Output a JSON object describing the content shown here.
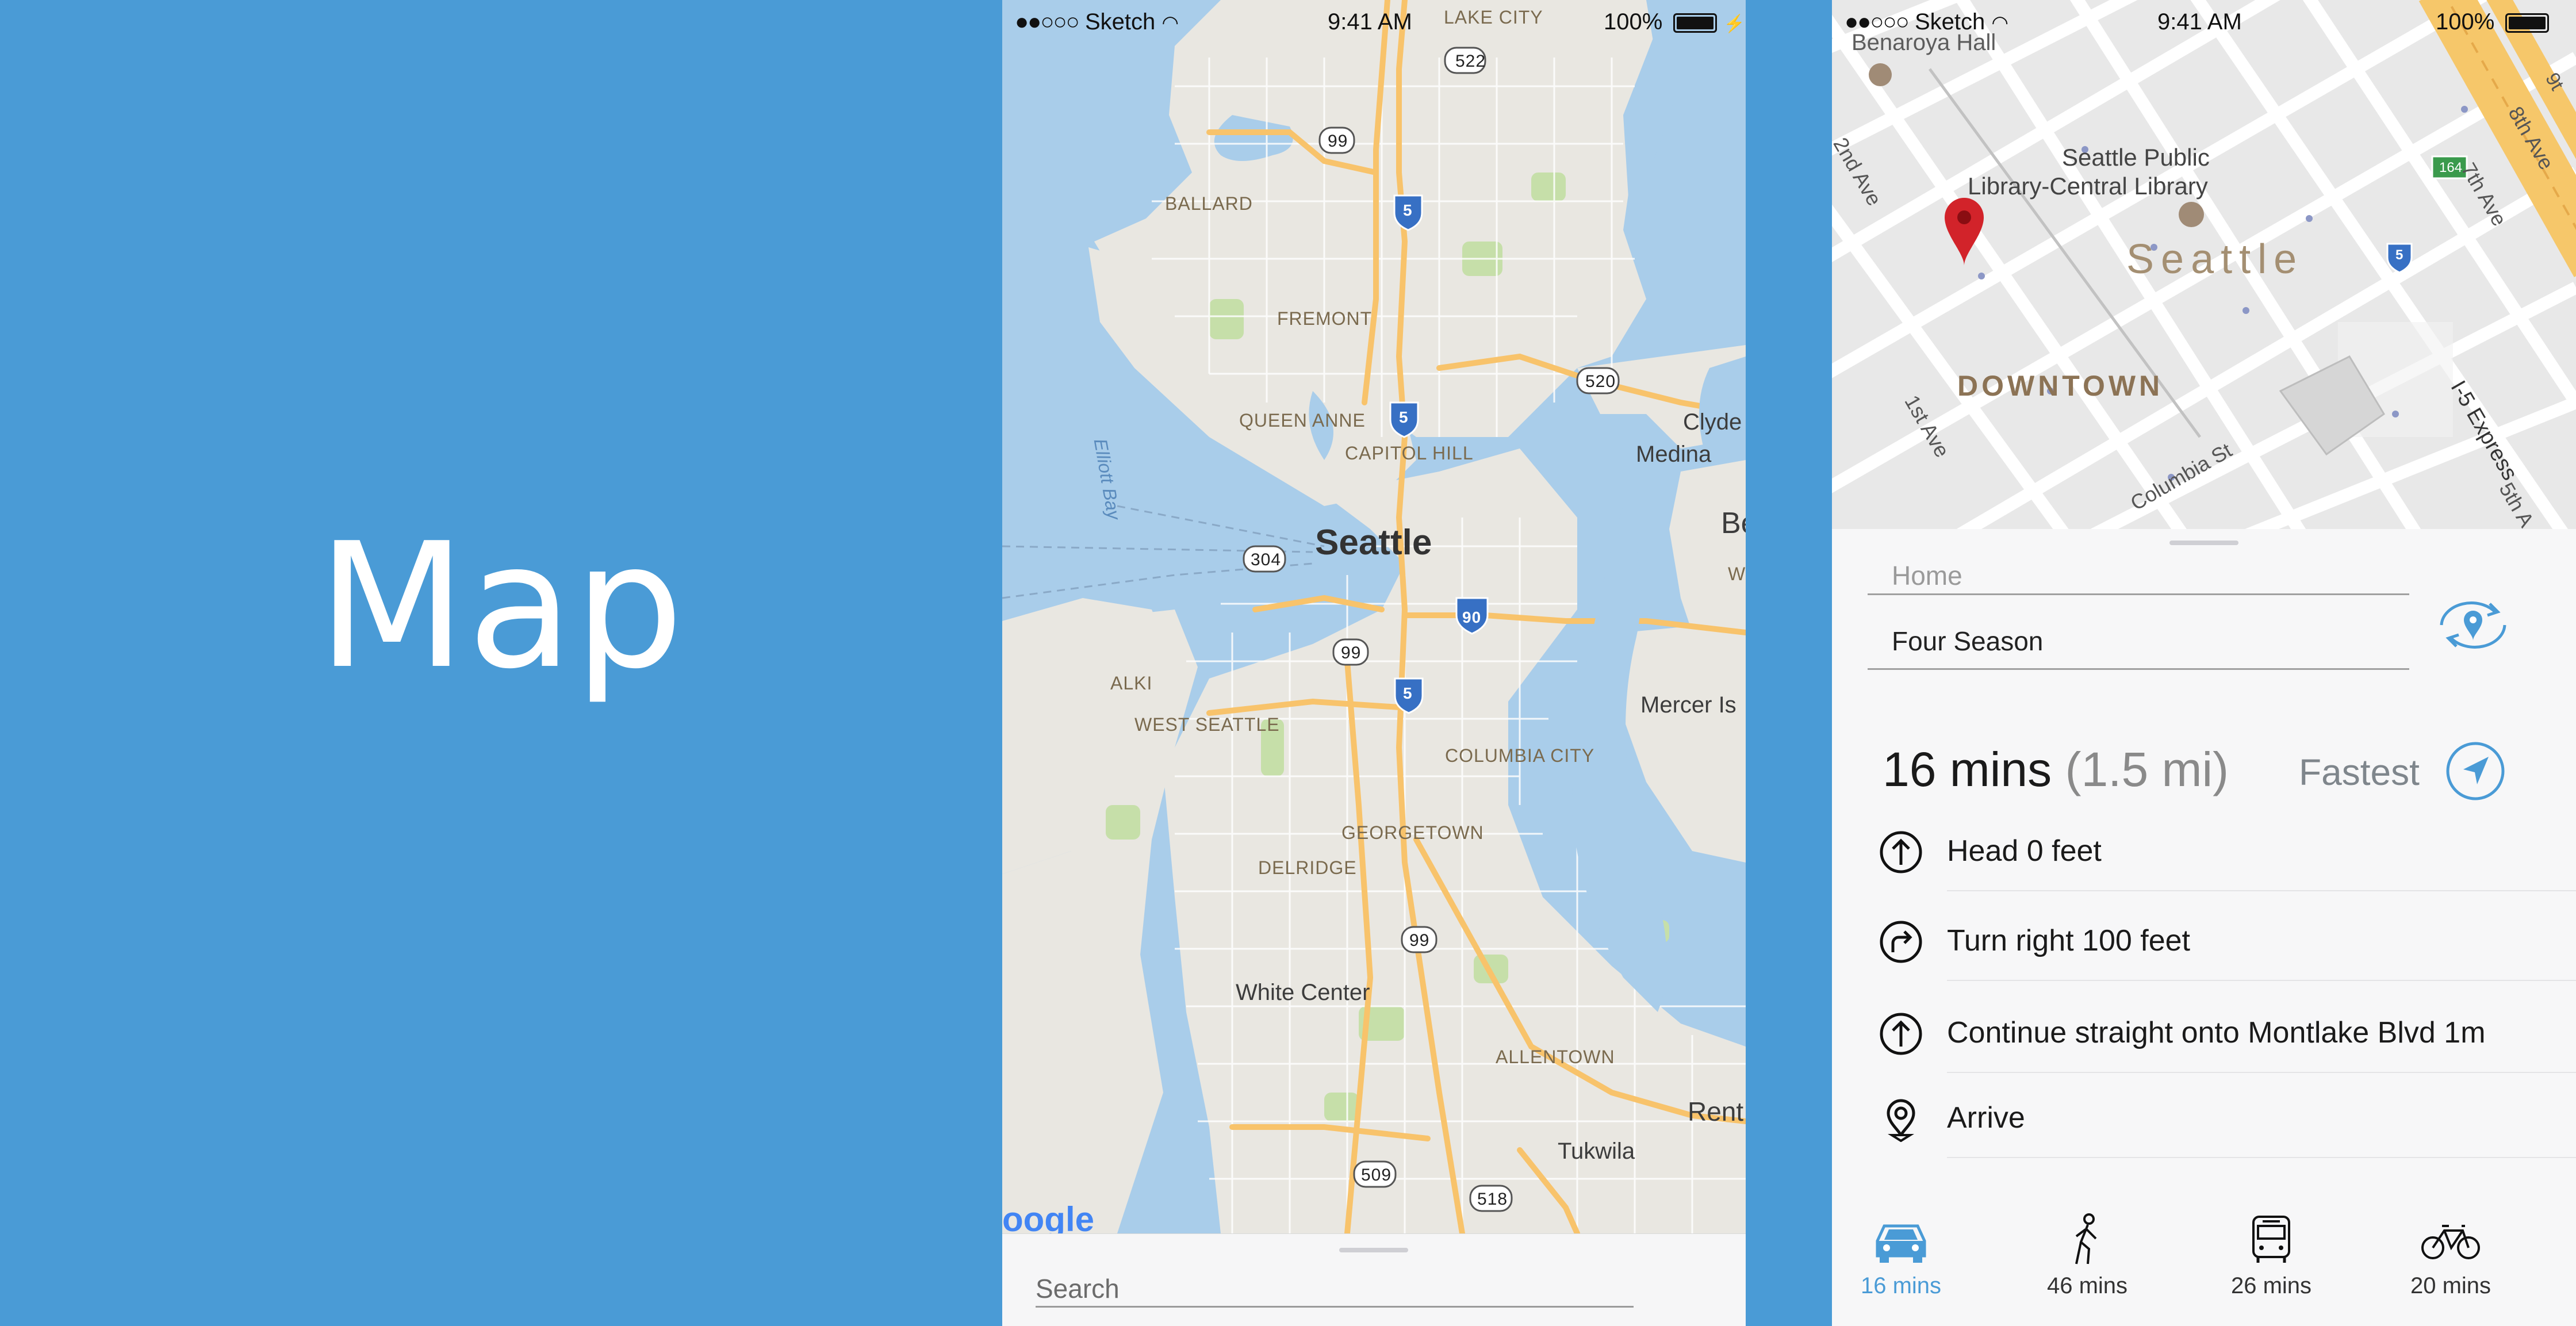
{
  "title_panel": {
    "title": "Map"
  },
  "status_bar": {
    "carrier": "Sketch",
    "time": "9:41 AM",
    "battery": "100%"
  },
  "map_overview": {
    "labels": {
      "city": "Seattle",
      "lake_city": "LAKE CITY",
      "ballard": "BALLARD",
      "fremont": "FREMONT",
      "queen_anne": "QUEEN ANNE",
      "capitol_hill": "CAPITOL HILL",
      "alki": "ALKI",
      "west_seattle": "WEST SEATTLE",
      "columbia_city": "COLUMBIA CITY",
      "georgetown": "GEORGETOWN",
      "delridge": "DELRIDGE",
      "white_center": "White Center",
      "allentown": "ALLENTOWN",
      "tukwila": "Tukwila",
      "renton": "Rent",
      "mercer": "Mercer Is",
      "clyde": "Clyde",
      "medina": "Medina",
      "be": "Be",
      "elliott_bay": "Elliott Bay",
      "google": "oogle",
      "shield_522": "522",
      "shield_99a": "99",
      "shield_5a": "5",
      "shield_520": "520",
      "shield_5b": "5",
      "shield_304": "304",
      "shield_90": "90",
      "shield_99b": "99",
      "shield_5c": "5",
      "shield_99c": "99",
      "shield_509": "509",
      "shield_518": "518",
      "ws": "Ws"
    },
    "search_placeholder": "Search"
  },
  "map_detail": {
    "labels": {
      "benaroya": "Benaroya Hall",
      "library_line1": "Seattle Public",
      "library_line2": "Library-Central Library",
      "city": "Seattle",
      "downtown": "DOWNTOWN",
      "ave_2nd": "2nd Ave",
      "ave_1st": "1st Ave",
      "columbia": "Columbia St",
      "ave_7th": "7th Ave",
      "ave_8th": "8th Ave",
      "ave_5th": "5th A",
      "i5_express": "I-5 Express",
      "shield_164": "164",
      "shield_5": "5",
      "edge_9": "9t"
    }
  },
  "directions": {
    "from_placeholder": "Home",
    "to_value": "Four Season",
    "summary_time": "16 mins",
    "summary_distance": "(1.5 mi)",
    "route_type": "Fastest",
    "steps": [
      {
        "icon": "arrow-up-circle-icon",
        "text": "Head 0 feet"
      },
      {
        "icon": "turn-right-circle-icon",
        "text": "Turn right 100 feet"
      },
      {
        "icon": "arrow-up-circle-icon",
        "text": "Continue straight onto Montlake Blvd 1m"
      },
      {
        "icon": "location-pin-icon",
        "text": "Arrive"
      }
    ],
    "modes": [
      {
        "icon": "car-icon",
        "label": "16 mins",
        "active": true
      },
      {
        "icon": "walk-icon",
        "label": "46 mins"
      },
      {
        "icon": "bus-icon",
        "label": "26 mins"
      },
      {
        "icon": "bike-icon",
        "label": "20 mins"
      }
    ]
  },
  "colors": {
    "accent": "#4a9bd6",
    "water": "#a9cdea",
    "land": "#e9e7e1",
    "highway": "#f8c36b",
    "pin": "#d2232a"
  }
}
